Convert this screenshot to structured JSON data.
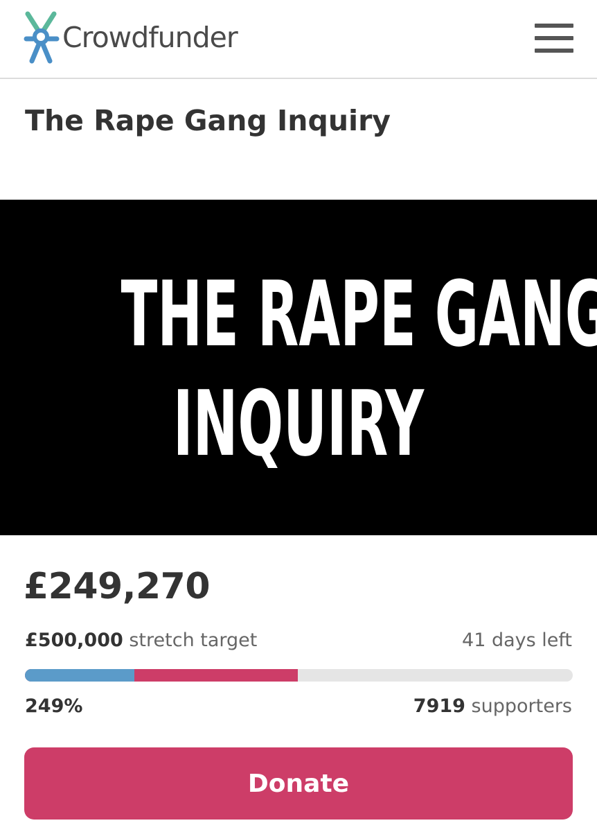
{
  "header": {
    "brand": "Crowdfunder",
    "logo_icon": "crowdfunder-figure-logo",
    "menu_icon": "hamburger-menu-icon",
    "brand_colors": {
      "figure_blue": "#4a8fc7",
      "figure_green": "#5bb89b",
      "text": "#4a4a4a"
    }
  },
  "project": {
    "title": "The Rape Gang Inquiry",
    "banner": {
      "line1": "THE RAPE GANG",
      "line2": "INQUIRY"
    }
  },
  "funding": {
    "amount_raised": "£249,270",
    "target_amount": "£500,000",
    "target_label": "stretch target",
    "days_left": "41 days left",
    "percent_funded": "249%",
    "supporters_count": "7919",
    "supporters_label": "supporters",
    "progress": {
      "first_target_fraction": 0.2,
      "raised_fraction": 0.4985,
      "colors": {
        "first_target": "#5b9bc9",
        "raised": "#cd3d68",
        "track": "#e5e5e5"
      }
    }
  },
  "actions": {
    "donate_label": "Donate",
    "donate_color": "#cd3d68"
  }
}
